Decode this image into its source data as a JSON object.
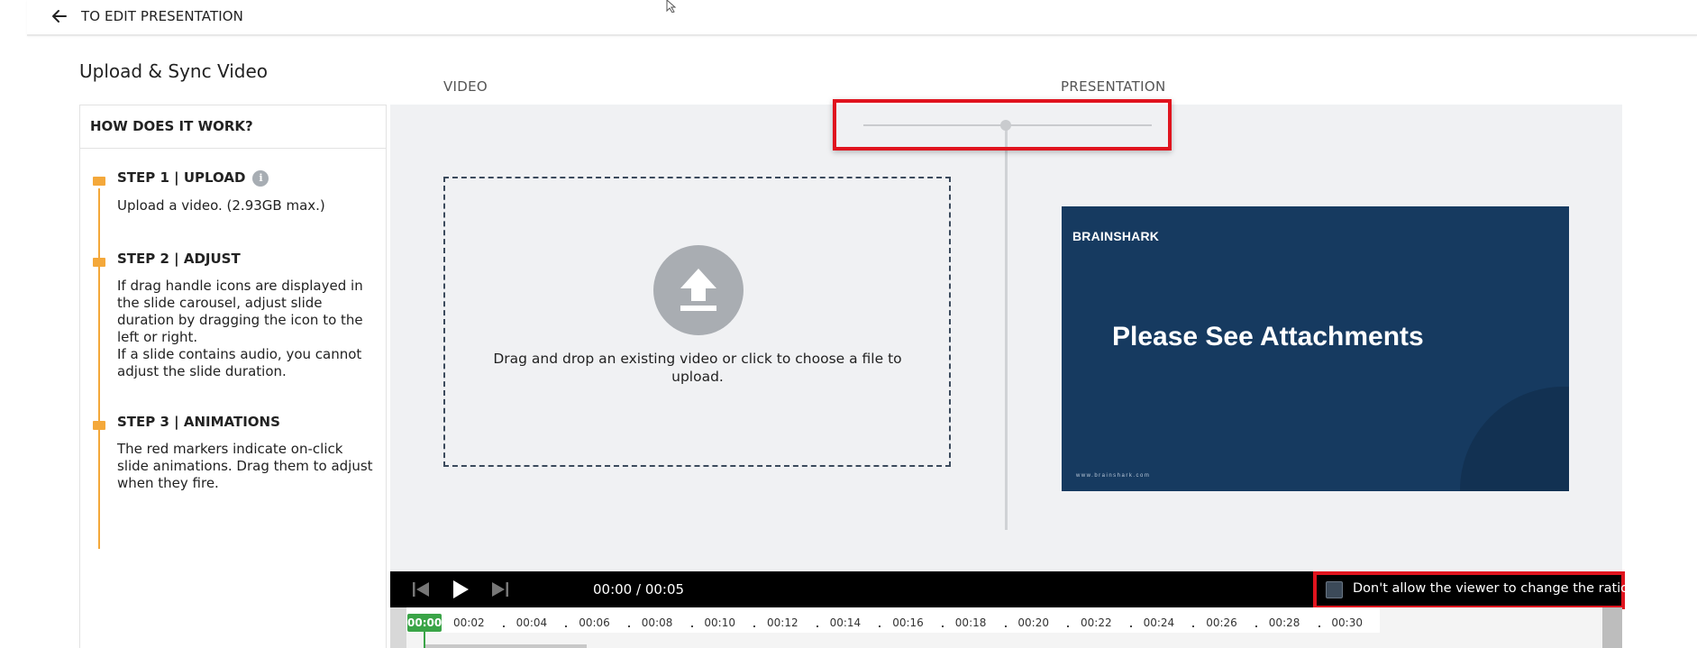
{
  "topbar": {
    "back_label": "TO EDIT PRESENTATION"
  },
  "page_title": "Upload & Sync Video",
  "how": {
    "heading": "HOW DOES IT WORK?",
    "steps": [
      {
        "title": "STEP 1 | UPLOAD",
        "body1": "Upload a video. (2.93GB max.)"
      },
      {
        "title": "STEP 2 | ADJUST",
        "body1": "If drag handle icons are displayed in the slide carousel, adjust slide duration by dragging the icon to the left or right.",
        "body2": "If a slide contains audio, you cannot adjust the slide duration."
      },
      {
        "title": "STEP 3 | ANIMATIONS",
        "body1": "The red markers indicate on-click slide animations. Drag them to adjust when they fire."
      }
    ],
    "info_glyph": "i"
  },
  "labels": {
    "video": "VIDEO",
    "presentation": "PRESENTATION"
  },
  "dropzone": {
    "text": "Drag and drop an existing video or click to choose a file to upload."
  },
  "slide": {
    "logo": "BRAINSHARK",
    "title": "Please See Attachments",
    "url": "www.brainshark.com"
  },
  "player": {
    "time": "00:00 / 00:05",
    "lock_label": "Don't allow the viewer to change the ratio.",
    "lock_checked": false
  },
  "timeline": {
    "current": "00:00",
    "ticks": [
      "00:02",
      "00:04",
      "00:06",
      "00:08",
      "00:10",
      "00:12",
      "00:14",
      "00:16",
      "00:18",
      "00:20",
      "00:22",
      "00:24",
      "00:26",
      "00:28",
      "00:30"
    ]
  },
  "colors": {
    "accent_orange": "#f4a83a",
    "highlight_red": "#e0141e",
    "slide_navy": "#163a60",
    "playhead_green": "#3aa447"
  }
}
